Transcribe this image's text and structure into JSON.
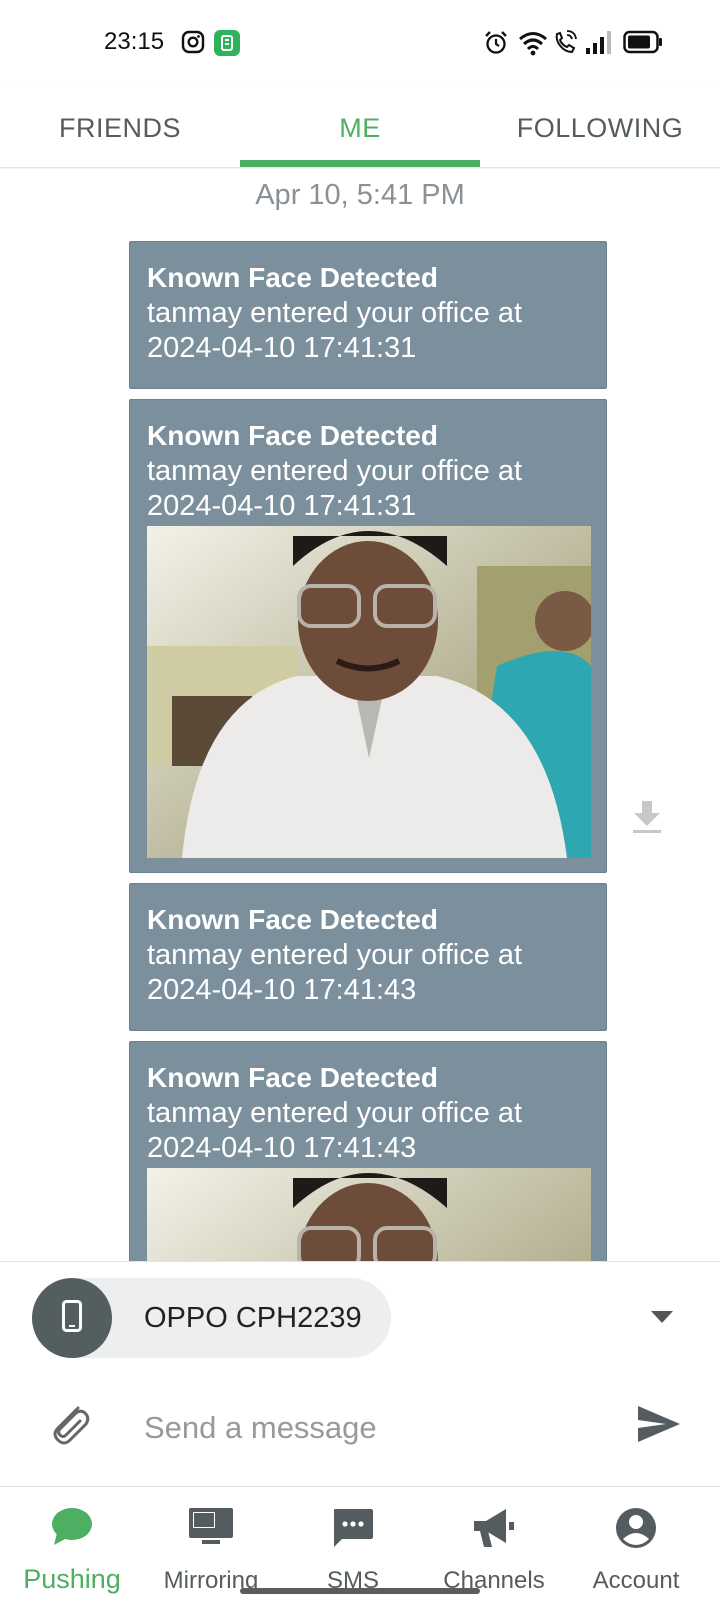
{
  "status_bar": {
    "time": "23:15"
  },
  "tabs": [
    {
      "label": "FRIENDS"
    },
    {
      "label": "ME"
    },
    {
      "label": "FOLLOWING"
    }
  ],
  "active_tab": "ME",
  "feed": {
    "date": "Apr 10, 5:41 PM",
    "messages": [
      {
        "title": "Known Face Detected",
        "body": "tanmay entered your office at 2024-04-10 17:41:31",
        "has_image": false
      },
      {
        "title": "Known Face Detected",
        "body": "tanmay entered your office at 2024-04-10 17:41:31",
        "has_image": true
      },
      {
        "title": "Known Face Detected",
        "body": "tanmay entered your office at 2024-04-10 17:41:43",
        "has_image": false
      },
      {
        "title": "Known Face Detected",
        "body": "tanmay entered your office at 2024-04-10 17:41:43",
        "has_image": true
      }
    ]
  },
  "composer": {
    "device_name": "OPPO CPH2239",
    "placeholder": "Send a message"
  },
  "bottom_nav": [
    {
      "label": "Pushing",
      "icon": "chat-bubble-icon"
    },
    {
      "label": "Mirroring",
      "icon": "monitor-icon"
    },
    {
      "label": "SMS",
      "icon": "sms-icon"
    },
    {
      "label": "Channels",
      "icon": "megaphone-icon"
    },
    {
      "label": "Account",
      "icon": "account-circle-icon"
    }
  ],
  "colors": {
    "accent": "#4caf62",
    "message_bg": "#7b8f9c",
    "device_avatar": "#535f5e"
  }
}
